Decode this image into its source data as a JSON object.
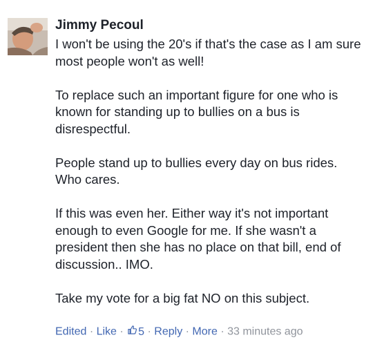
{
  "comment": {
    "author": "Jimmy Pecoul",
    "avatar": "profile-photo",
    "paragraphs": [
      "I won't be using the 20's if that's the case as I am sure most people won't as well!",
      "To replace such an important figure for one who is known for standing up to bullies on a bus is disrespectful.",
      "People stand up to bullies every day on bus rides. Who cares.",
      "If this was even her. Either way it's not important enough to even Google for me. If she wasn't a president then she has no place on that bill, end of discussion.. IMO.",
      "Take my vote for a big fat NO on this subject."
    ],
    "actions": {
      "edited": "Edited",
      "sep": " · ",
      "like": "Like",
      "like_icon": "thumbs-up-icon",
      "like_count": "5",
      "reply": "Reply",
      "more": "More",
      "timestamp": "33 minutes ago"
    },
    "colors": {
      "text": "#1d2129",
      "link": "#4267b2",
      "meta": "#90949c"
    }
  }
}
